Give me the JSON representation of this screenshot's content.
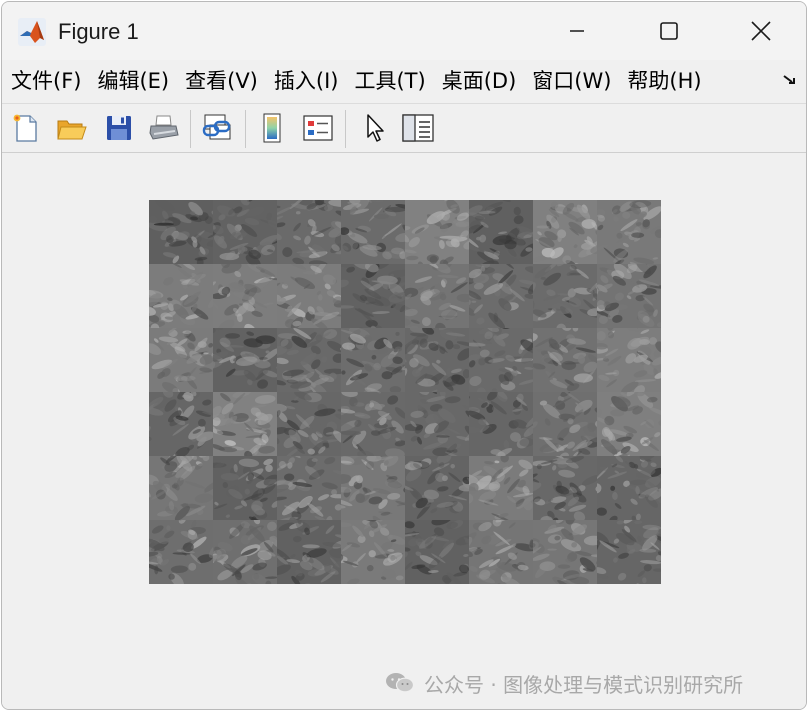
{
  "window": {
    "title": "Figure 1"
  },
  "menubar": {
    "items": [
      "文件(F)",
      "编辑(E)",
      "查看(V)",
      "插入(I)",
      "工具(T)",
      "桌面(D)",
      "窗口(W)",
      "帮助(H)"
    ]
  },
  "toolbar": {
    "buttons": [
      {
        "name": "new-figure-icon"
      },
      {
        "name": "open-file-icon"
      },
      {
        "name": "save-icon"
      },
      {
        "name": "print-icon"
      },
      {
        "name": "link-plot-icon"
      },
      {
        "name": "insert-colorbar-icon"
      },
      {
        "name": "insert-legend-icon"
      },
      {
        "name": "edit-plot-cursor-icon"
      },
      {
        "name": "property-inspector-icon"
      }
    ]
  },
  "figure": {
    "image_grid": {
      "rows": 6,
      "cols": 8,
      "colormap": "gray"
    }
  },
  "watermark": {
    "text": "公众号 · 图像处理与模式识别研究所"
  },
  "colors": {
    "window_bg": "#f0f0f0",
    "title_bar": "#f3f3f3",
    "watermark": "#a8a8a8"
  }
}
